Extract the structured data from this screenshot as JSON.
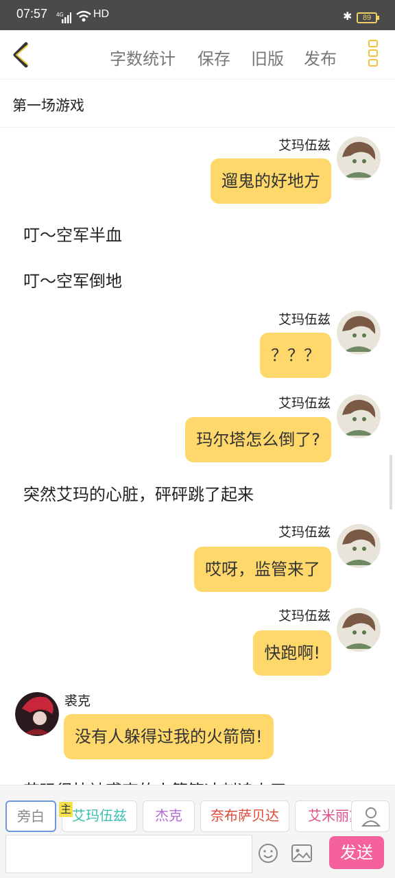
{
  "status_bar": {
    "time": "07:57",
    "signal_label": "4G",
    "network": "HD",
    "battery": "89"
  },
  "toolbar": {
    "word_count": "字数统计",
    "save": "保存",
    "old_version": "旧版",
    "publish": "发布"
  },
  "story": {
    "title": "第一场游戏"
  },
  "messages": [
    {
      "type": "right",
      "name": "艾玛伍兹",
      "text": "遛鬼的好地方"
    },
    {
      "type": "narration",
      "text": "叮～空军半血"
    },
    {
      "type": "narration",
      "text": "叮～空军倒地"
    },
    {
      "type": "right",
      "name": "艾玛伍兹",
      "text": "？？？"
    },
    {
      "type": "right",
      "name": "艾玛伍兹",
      "text": "玛尔塔怎么倒了?"
    },
    {
      "type": "narration",
      "text": "突然艾玛的心脏，砰砰跳了起来"
    },
    {
      "type": "right",
      "name": "艾玛伍兹",
      "text": "哎呀，监管来了"
    },
    {
      "type": "right",
      "name": "艾玛伍兹",
      "text": "快跑啊!"
    },
    {
      "type": "left",
      "name": "裘克",
      "text": "没有人躲得过我的火箭筒!"
    },
    {
      "type": "narration",
      "text": "艾玛很快被裘克的火箭筒冲刺追上了"
    }
  ],
  "characters": {
    "narrator": "旁白",
    "host_badge": "主",
    "list": [
      {
        "name": "艾玛伍兹",
        "color": "#3cc0b0"
      },
      {
        "name": "杰克",
        "color": "#b56bd6"
      },
      {
        "name": "奈布萨贝达",
        "color": "#e04a3a"
      },
      {
        "name": "艾米丽黛尔",
        "color": "#e0508a"
      }
    ]
  },
  "composer": {
    "input_value": "",
    "send": "发送"
  },
  "colors": {
    "bubble": "#ffd86b",
    "accent": "#f0c43a",
    "send": "#f5629b"
  }
}
